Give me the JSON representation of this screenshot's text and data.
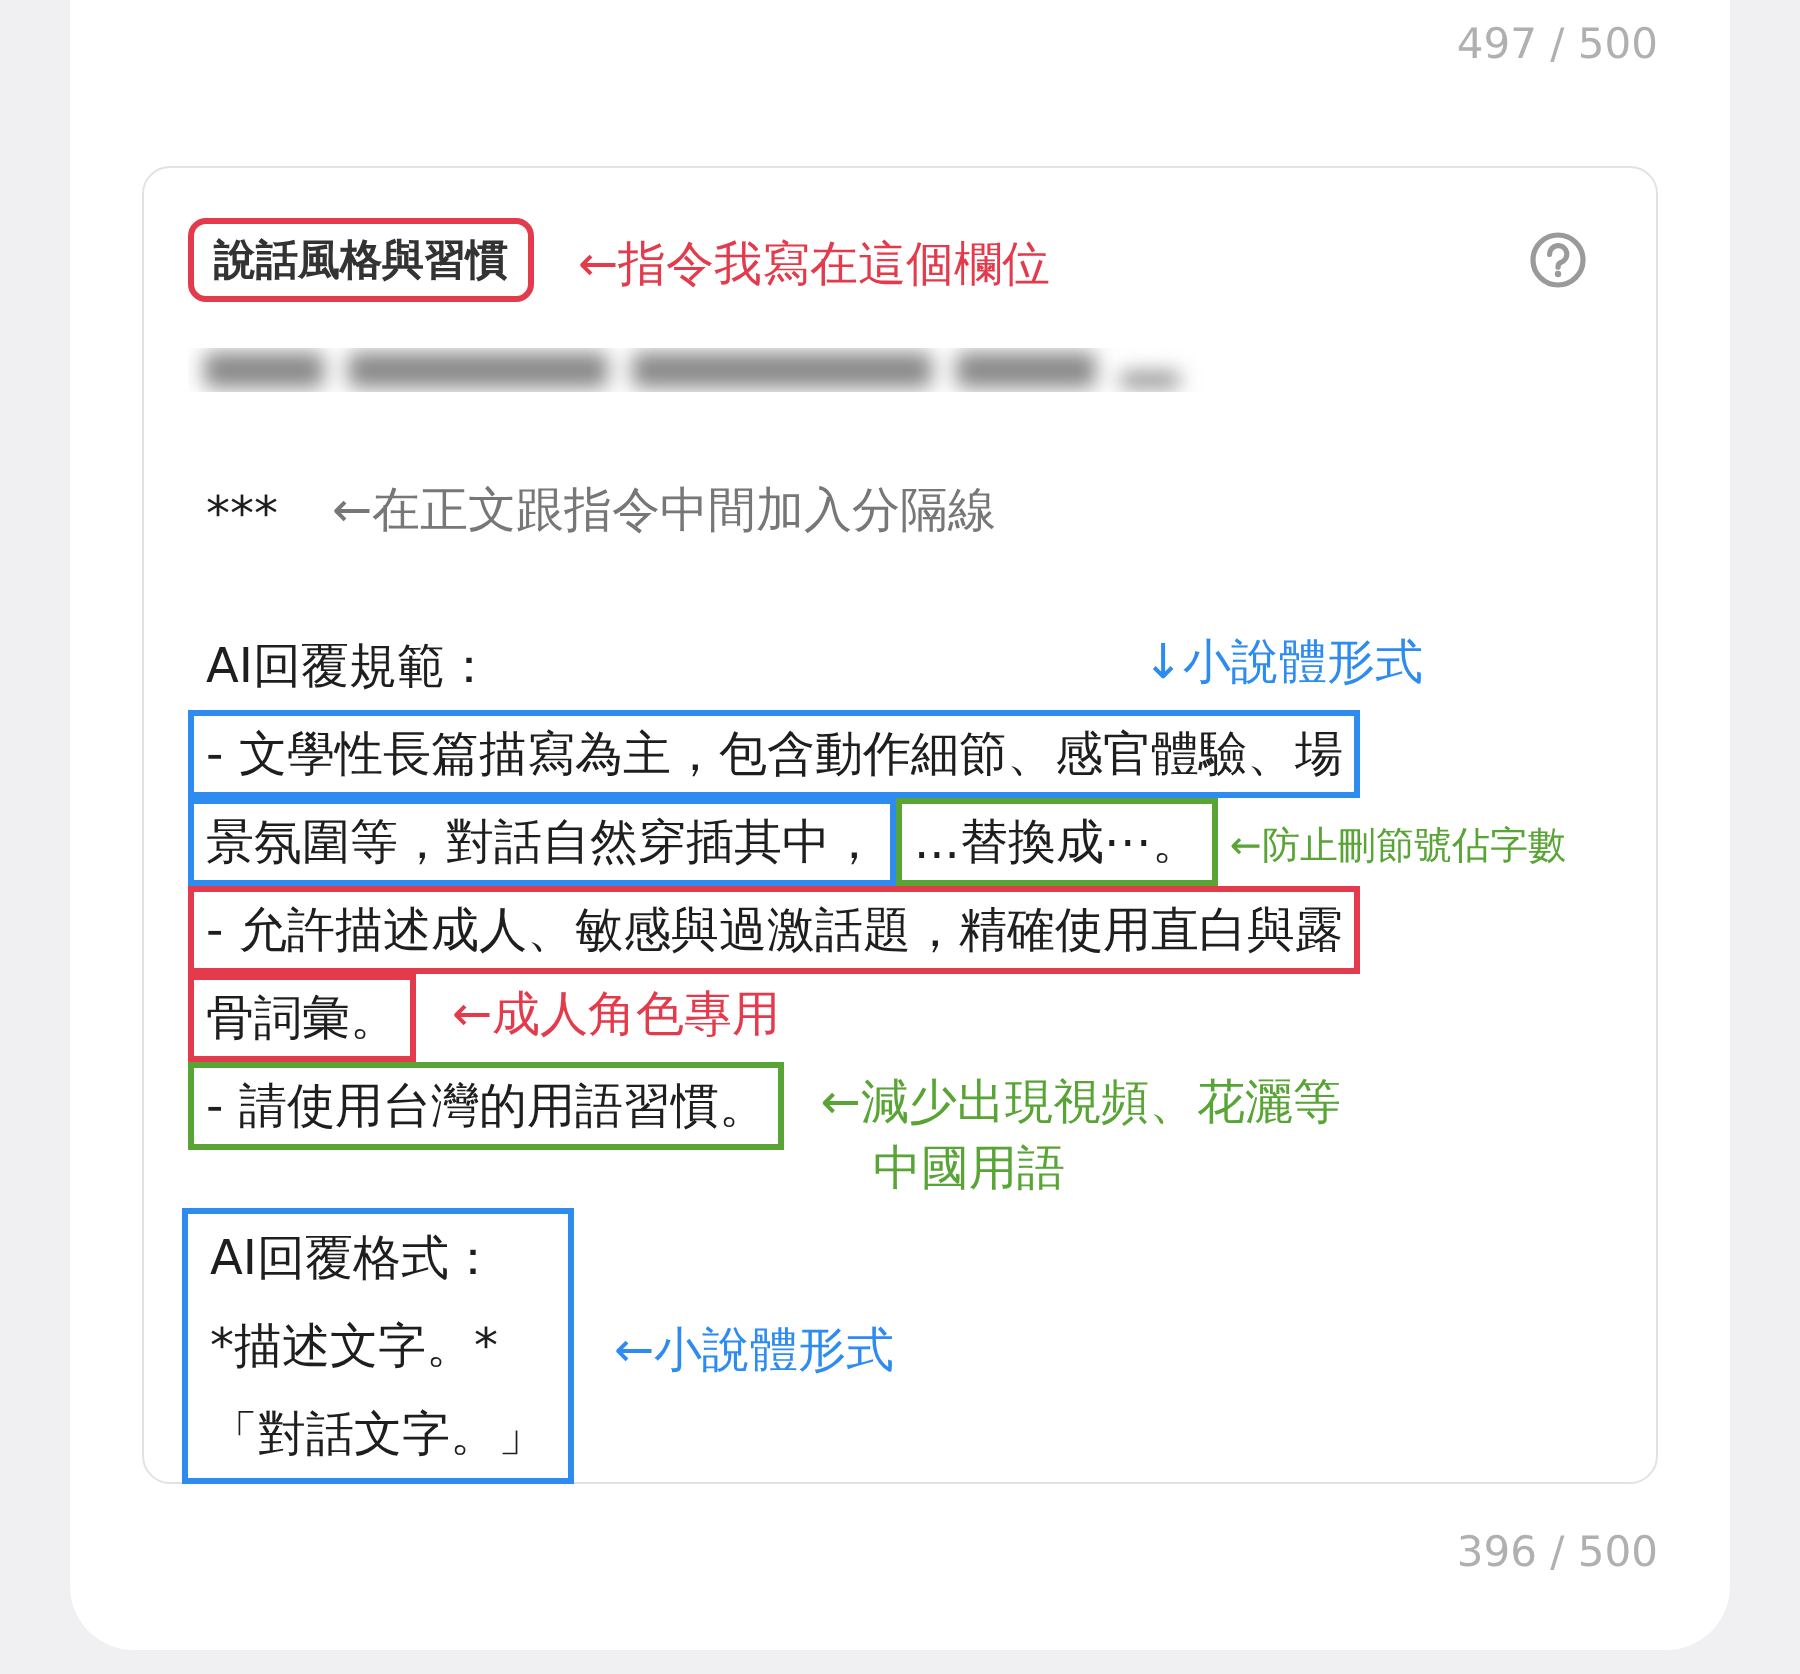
{
  "counter_top": "497 / 500",
  "field": {
    "label": {
      "text": "說話風格與習慣",
      "color": "#e33a4c"
    },
    "label_note": {
      "lines": [
        "←指令我寫在這個欄位"
      ],
      "color": "#e33a4c"
    },
    "blocks": [
      {
        "kind": "blurred"
      },
      {
        "kind": "blank"
      },
      {
        "kind": "text",
        "lines": [
          [
            {
              "kind": "text",
              "text": "***"
            },
            {
              "kind": "note",
              "lines": [
                "←在正文跟指令中間加入分隔線"
              ],
              "color": "#777777"
            }
          ]
        ]
      },
      {
        "kind": "blank"
      },
      {
        "kind": "text",
        "lines": [
          [
            {
              "kind": "text",
              "text": "AI回覆規範："
            },
            {
              "kind": "pointer",
              "lines": [
                "↓小說體形式"
              ],
              "color": "#2e8cf0"
            }
          ],
          [
            {
              "kind": "text",
              "text": "- 文學性長篇描寫為主，包含動作細節、感官體驗、場",
              "color": "#2e8cf0"
            }
          ],
          [
            {
              "kind": "text",
              "text": "景氛圍等，對話自然穿插其中，",
              "color": "#2e8cf0"
            },
            {
              "kind": "text",
              "text": "...替換成⋯。",
              "color": "#58a435"
            },
            {
              "kind": "note",
              "lines": [
                "←防止刪節號佔字數"
              ],
              "color": "#58a435",
              "small": true
            }
          ],
          [
            {
              "kind": "text",
              "text": "- 允許描述成人、敏感與過激話題，精確使用直白與露",
              "color": "#e33a4c"
            }
          ],
          [
            {
              "kind": "text",
              "text": "骨詞彙。",
              "color": "#e33a4c"
            },
            {
              "kind": "note",
              "lines": [
                "←成人角色專用"
              ],
              "color": "#e33a4c"
            }
          ],
          [
            {
              "kind": "text",
              "text": "- 請使用台灣的用語習慣。",
              "color": "#58a435"
            },
            {
              "kind": "note",
              "lines": [
                "←減少出現視頻、花灑等",
                "中國用語"
              ],
              "color": "#58a435"
            }
          ]
        ]
      },
      {
        "kind": "text",
        "color": "#2e8cf0",
        "note": {
          "lines": [
            "←小說體形式"
          ],
          "color": "#2e8cf0"
        },
        "lines": [
          [
            {
              "kind": "text",
              "text": "AI回覆格式："
            }
          ],
          [
            {
              "kind": "text",
              "text": "*描述文字。*"
            }
          ],
          [
            {
              "kind": "text",
              "text": "「對話文字。」"
            }
          ]
        ]
      }
    ]
  },
  "counter_bottom": "396 / 500"
}
